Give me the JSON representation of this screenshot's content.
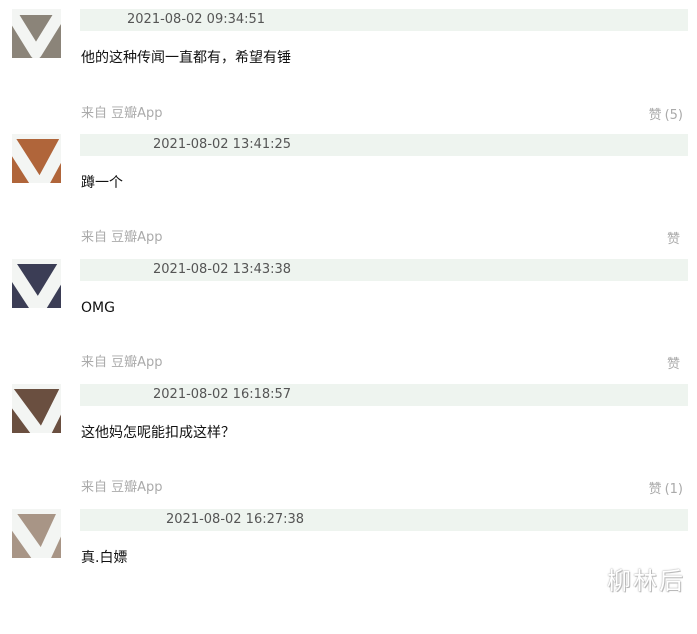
{
  "comments": [
    {
      "timestamp": "2021-08-02 09:34:51",
      "text": "他的这种传闻一直都有，希望有锤",
      "source": "来自 豆瓣App",
      "like_label": "赞",
      "like_count": "(5)",
      "avatar_color": "#8b8479"
    },
    {
      "timestamp": "2021-08-02 13:41:25",
      "text": "蹲一个",
      "source": "来自 豆瓣App",
      "like_label": "赞",
      "like_count": "",
      "avatar_color": "#b0653a"
    },
    {
      "timestamp": "2021-08-02 13:43:38",
      "text": "OMG",
      "source": "来自 豆瓣App",
      "like_label": "赞",
      "like_count": "",
      "avatar_color": "#3b3d55"
    },
    {
      "timestamp": "2021-08-02 16:18:57",
      "text": "这他妈怎呢能扣成这样？",
      "source": "来自 豆瓣App",
      "like_label": "赞",
      "like_count": "(1)",
      "avatar_color": "#6a4f40"
    },
    {
      "timestamp": "2021-08-02 16:27:38",
      "text": "真.白嫖",
      "source": "",
      "like_label": "",
      "like_count": "",
      "avatar_color": "#a89586"
    }
  ],
  "watermark": "柳林后"
}
